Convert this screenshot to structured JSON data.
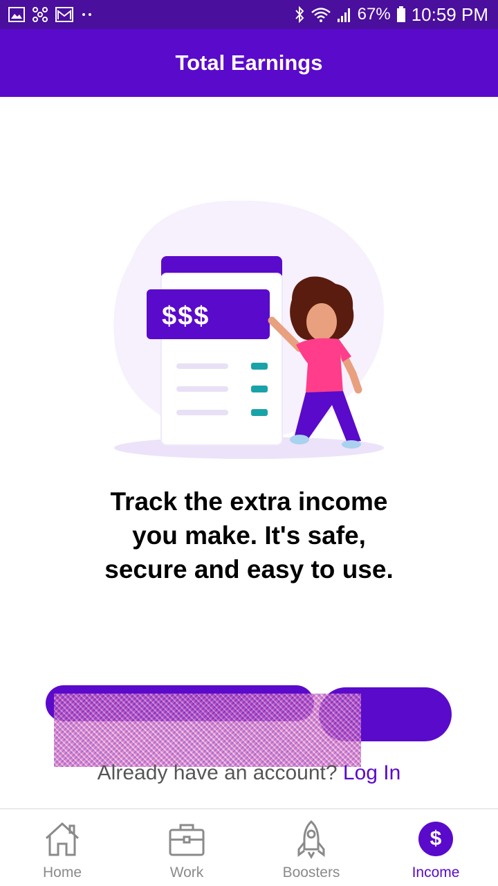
{
  "status_bar": {
    "battery": "67%",
    "time": "10:59 PM",
    "left_icons": [
      "image-icon",
      "bluetooth-share-icon",
      "gmail-icon",
      "more-dots-icon"
    ],
    "right_icons": [
      "bluetooth-icon",
      "wifi-icon",
      "signal-icon",
      "battery-icon"
    ]
  },
  "app_bar": {
    "title": "Total Earnings"
  },
  "illustration": {
    "badge_text": "$$$"
  },
  "headline": {
    "line1": "Track the extra income",
    "line2": "you make. It's safe,",
    "line3": "secure and easy to use."
  },
  "login": {
    "prompt": "Already have an account?",
    "link": "Log In"
  },
  "bottom_nav": {
    "items": [
      {
        "label": "Home",
        "icon": "home-icon"
      },
      {
        "label": "Work",
        "icon": "briefcase-icon"
      },
      {
        "label": "Boosters",
        "icon": "rocket-icon"
      },
      {
        "label": "Income",
        "icon": "dollar-icon"
      }
    ],
    "active_index": 3
  },
  "colors": {
    "primary": "#5a0acb",
    "status_bar": "#4a0f9c",
    "accent_pink": "#ff3d8b",
    "teal": "#19a3a8"
  }
}
